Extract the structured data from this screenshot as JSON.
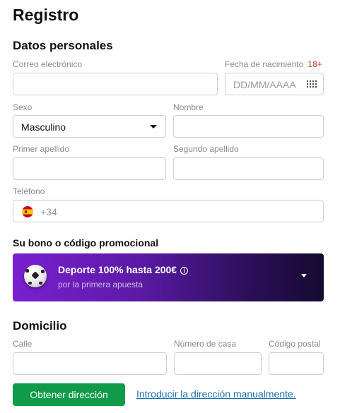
{
  "page": {
    "title": "Registro"
  },
  "personal": {
    "heading": "Datos personales",
    "email": {
      "label": "Correo electrónico",
      "value": ""
    },
    "birthdate": {
      "label": "Fecha de nacimiento",
      "badge": "18+",
      "placeholder": "DD/MM/AAAA",
      "icon": "calendar-grid-icon"
    },
    "sex": {
      "label": "Sexo",
      "value": "Masculino",
      "icon": "caret-down-icon"
    },
    "name": {
      "label": "Nombre",
      "value": ""
    },
    "first_surname": {
      "label": "Primer apellido",
      "value": ""
    },
    "second_surname": {
      "label": "Segundo apellido",
      "value": ""
    },
    "phone": {
      "label": "Teléfono",
      "prefix": "+34",
      "flag": "spain-flag-icon"
    }
  },
  "promo": {
    "heading": "Su bono o código promocional",
    "title": "Deporte 100% hasta 200€",
    "info_icon": "i",
    "subtitle": "por la primera apuesta",
    "colors": {
      "start": "#7a1fd0",
      "end": "#150a30"
    }
  },
  "address": {
    "heading": "Domicilio",
    "street": {
      "label": "Calle",
      "value": ""
    },
    "house_number": {
      "label": "Número de casa",
      "value": ""
    },
    "postal_code": {
      "label": "Código postal",
      "value": ""
    },
    "get_address_button": "Obtener dirección",
    "manual_link": "Introducir la dirección manualmente."
  },
  "colors": {
    "accent_green": "#0f9b49",
    "link_blue": "#1a6fb0",
    "required_red": "#c0392b"
  }
}
